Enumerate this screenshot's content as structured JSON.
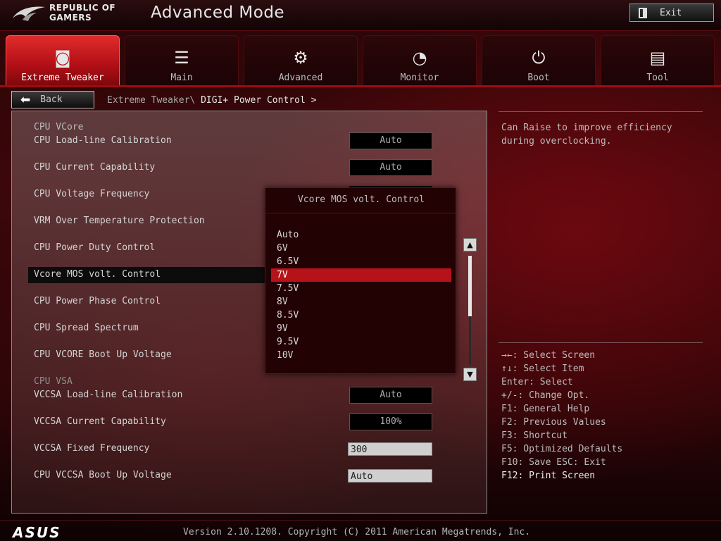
{
  "header": {
    "brand_line1": "REPUBLIC OF",
    "brand_line2": "GAMERS",
    "mode_title": "Advanced Mode",
    "exit_label": "Exit"
  },
  "tabs": [
    {
      "label": "Extreme Tweaker",
      "icon": "tweaker-icon",
      "glyph": "◙",
      "active": true
    },
    {
      "label": "Main",
      "icon": "list-icon",
      "glyph": "☰",
      "active": false
    },
    {
      "label": "Advanced",
      "icon": "settings-info-icon",
      "glyph": "⚙",
      "active": false
    },
    {
      "label": "Monitor",
      "icon": "gauge-icon",
      "glyph": "◔",
      "active": false
    },
    {
      "label": "Boot",
      "icon": "power-icon",
      "glyph": "⏻",
      "active": false
    },
    {
      "label": "Tool",
      "icon": "toolbox-icon",
      "glyph": "▤",
      "active": false
    }
  ],
  "nav": {
    "back_label": "Back",
    "breadcrumb_parent": "Extreme Tweaker\\ ",
    "breadcrumb_current": "DIGI+ Power Control >"
  },
  "settings": {
    "section_vcore": "CPU VCore",
    "rows": [
      {
        "label": "CPU Load-line Calibration",
        "value": "Auto"
      },
      {
        "label": "CPU Current Capability",
        "value": "Auto"
      },
      {
        "label": "CPU Voltage Frequency",
        "value": ""
      },
      {
        "label": "VRM Over Temperature Protection",
        "value": ""
      },
      {
        "label": "CPU Power Duty Control",
        "value": ""
      },
      {
        "label": "Vcore MOS volt. Control",
        "value": ""
      },
      {
        "label": "CPU Power Phase Control",
        "value": ""
      },
      {
        "label": "CPU Spread Spectrum",
        "value": ""
      },
      {
        "label": "CPU VCORE Boot Up Voltage",
        "value": ""
      }
    ],
    "section_vsa": "CPU VSA",
    "vsa_rows": [
      {
        "label": "VCCSA Load-line Calibration",
        "value": "Auto"
      },
      {
        "label": "VCCSA Current Capability",
        "value": "100%"
      },
      {
        "label": "VCCSA Fixed Frequency",
        "value": "300"
      },
      {
        "label": "CPU VCCSA Boot Up Voltage",
        "value": "Auto"
      }
    ]
  },
  "popup": {
    "title": "Vcore MOS volt. Control",
    "options": [
      "Auto",
      "6V",
      "6.5V",
      "7V",
      "7.5V",
      "8V",
      "8.5V",
      "9V",
      "9.5V",
      "10V"
    ],
    "selected": "7V",
    "scroll_fraction_visible": 0.55
  },
  "help": {
    "description": "Can Raise to improve efficiency during overclocking.",
    "keys": [
      "→←: Select Screen",
      "↑↓: Select Item",
      "Enter: Select",
      "+/-: Change Opt.",
      "F1: General Help",
      "F2: Previous Values",
      "F3: Shortcut",
      "F5: Optimized Defaults",
      "F10: Save  ESC: Exit",
      "F12: Print Screen"
    ]
  },
  "footer": {
    "brand": "ASUS",
    "version": "Version 2.10.1208. Copyright (C) 2011 American Megatrends, Inc."
  },
  "colors": {
    "accent": "#b5121a",
    "active_tab": "#e02c2c",
    "background": "#2a0507"
  }
}
